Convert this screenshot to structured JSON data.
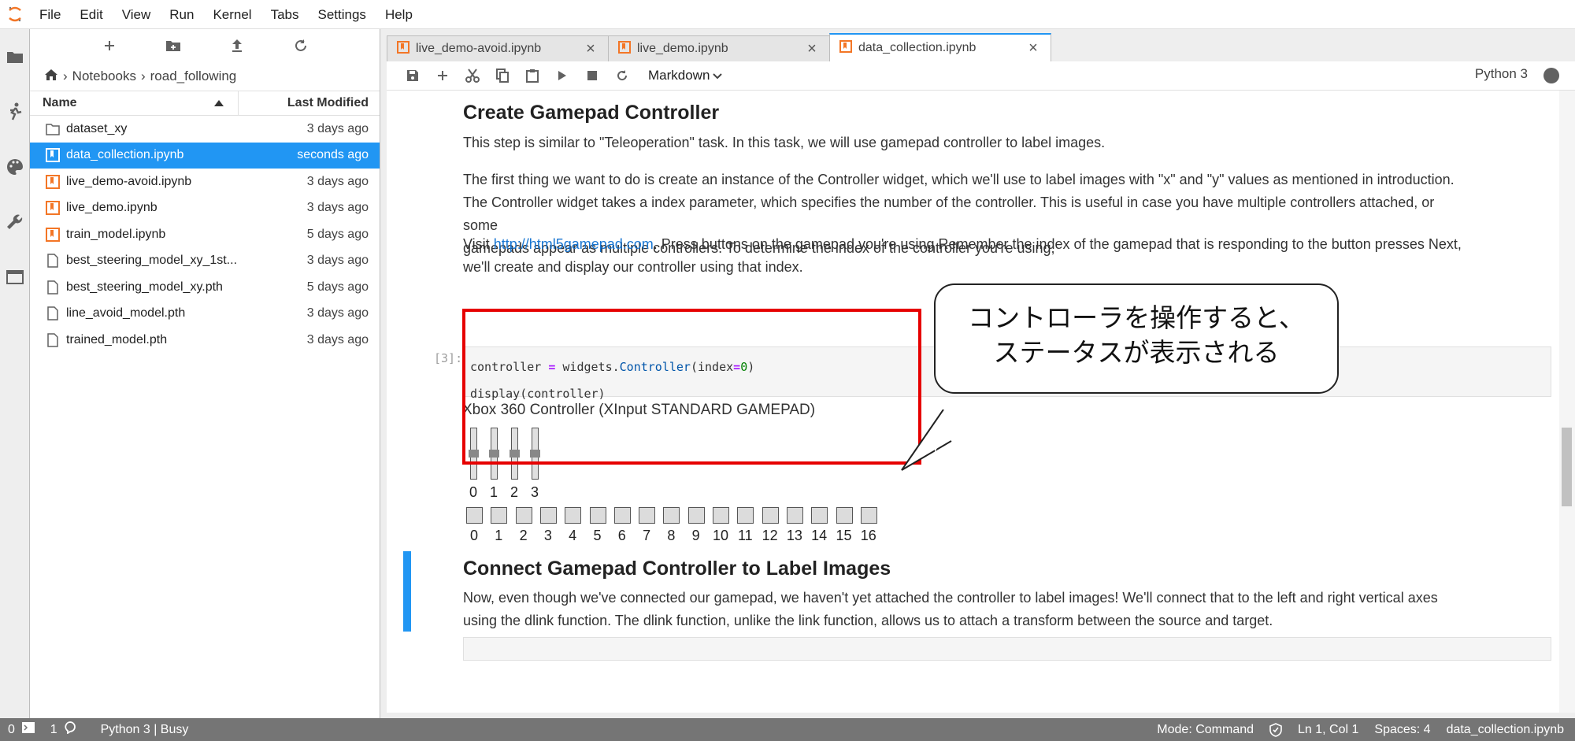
{
  "menubar": {
    "items": [
      "File",
      "Edit",
      "View",
      "Run",
      "Kernel",
      "Tabs",
      "Settings",
      "Help"
    ]
  },
  "activitybar": {
    "icons": [
      "folder-icon",
      "running-icon",
      "palette-icon",
      "wrench-icon",
      "tabs-icon"
    ]
  },
  "filebrowser": {
    "breadcrumb": [
      "Notebooks",
      "road_following"
    ],
    "columns": {
      "name": "Name",
      "modified": "Last Modified"
    },
    "files": [
      {
        "name": "dataset_xy",
        "modified": "3 days ago",
        "type": "folder"
      },
      {
        "name": "data_collection.ipynb",
        "modified": "seconds ago",
        "type": "notebook",
        "selected": true
      },
      {
        "name": "live_demo-avoid.ipynb",
        "modified": "3 days ago",
        "type": "notebook"
      },
      {
        "name": "live_demo.ipynb",
        "modified": "3 days ago",
        "type": "notebook"
      },
      {
        "name": "train_model.ipynb",
        "modified": "5 days ago",
        "type": "notebook"
      },
      {
        "name": "best_steering_model_xy_1st...",
        "modified": "3 days ago",
        "type": "file"
      },
      {
        "name": "best_steering_model_xy.pth",
        "modified": "5 days ago",
        "type": "file"
      },
      {
        "name": "line_avoid_model.pth",
        "modified": "3 days ago",
        "type": "file"
      },
      {
        "name": "trained_model.pth",
        "modified": "3 days ago",
        "type": "file"
      }
    ]
  },
  "tabs": [
    {
      "label": "live_demo-avoid.ipynb",
      "active": false
    },
    {
      "label": "live_demo.ipynb",
      "active": false
    },
    {
      "label": "data_collection.ipynb",
      "active": true
    }
  ],
  "toolbar": {
    "cell_type": "Markdown",
    "kernel": "Python 3"
  },
  "notebook": {
    "h_create": "Create Gamepad Controller",
    "p1": "This step is similar to \"Teleoperation\" task. In this task, we will use gamepad controller to label images.",
    "p2_line1": "The first thing we want to do is create an instance of the Controller widget, which we'll use to label images with \"x\" and \"y\" values as mentioned in introduction.",
    "p2_line2": "The Controller widget takes a index parameter, which specifies the number of the controller. This is useful in case you have multiple controllers attached, or some",
    "p2_line3": "gamepads appear as multiple controllers. To determine the index of the controller you're using,",
    "p3_visit": "Visit ",
    "p3_link": "http://html5gamepad.com",
    "p3_rest": ". Press buttons on the gamepad you're using Remember the index of the gamepad that is responding to the button presses Next,",
    "p3_line2": "we'll create and display our controller using that index.",
    "prompt": "[3]:",
    "code_line1_a": "controller ",
    "code_line1_op": "=",
    "code_line1_b": " widgets.",
    "code_line1_cls": "Controller",
    "code_line1_c": "(index",
    "code_line1_op2": "=",
    "code_line1_num": "0",
    "code_line1_d": ")",
    "code_line2": "display(controller)",
    "widget_title": "Xbox 360 Controller (XInput STANDARD GAMEPAD)",
    "axes": [
      "0",
      "1",
      "2",
      "3"
    ],
    "buttons": [
      "0",
      "1",
      "2",
      "3",
      "4",
      "5",
      "6",
      "7",
      "8",
      "9",
      "10",
      "11",
      "12",
      "13",
      "14",
      "15",
      "16"
    ],
    "h_connect": "Connect Gamepad Controller to Label Images",
    "p4_line1": "Now, even though we've connected our gamepad, we haven't yet attached the controller to label images! We'll connect that to the left and right vertical axes",
    "p4_line2": "using the dlink function. The dlink function, unlike the link function, allows us to attach a transform between the source and target."
  },
  "callout": {
    "line1": "コントローラを操作すると、",
    "line2": "ステータスが表示される"
  },
  "statusbar": {
    "terminals": "0",
    "kernels": "1",
    "kernel_status": "Python 3 | Busy",
    "mode": "Mode: Command",
    "position": "Ln 1, Col 1",
    "spaces": "Spaces: 4",
    "filename": "data_collection.ipynb"
  },
  "colors": {
    "accent": "#2196f3",
    "highlight": "#e60000",
    "notebook_icon": "#f37626"
  }
}
